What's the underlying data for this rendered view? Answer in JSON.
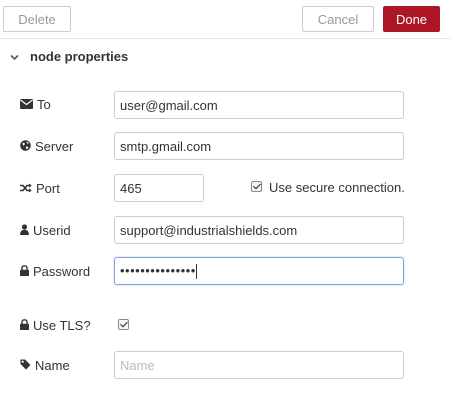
{
  "toolbar": {
    "delete_label": "Delete",
    "cancel_label": "Cancel",
    "done_label": "Done",
    "done_color": "#ad1625"
  },
  "section": {
    "title": "node properties",
    "chevron_icon": "chevron-down-icon"
  },
  "fields": {
    "to": {
      "label": "To",
      "icon": "envelope-icon",
      "value": "user@gmail.com"
    },
    "server": {
      "label": "Server",
      "icon": "globe-icon",
      "value": "smtp.gmail.com"
    },
    "port": {
      "label": "Port",
      "icon": "random-icon",
      "value": "465"
    },
    "secure": {
      "label": "Use secure connection.",
      "checked": true
    },
    "userid": {
      "label": "Userid",
      "icon": "user-icon",
      "value": "support@industrialshields.com"
    },
    "password": {
      "label": "Password",
      "icon": "lock-icon",
      "value": "•••••••••••••••"
    },
    "tls": {
      "label": "Use TLS?",
      "icon": "lock-icon",
      "checked": true
    },
    "name": {
      "label": "Name",
      "icon": "tag-icon",
      "value": "",
      "placeholder": "Name"
    }
  }
}
